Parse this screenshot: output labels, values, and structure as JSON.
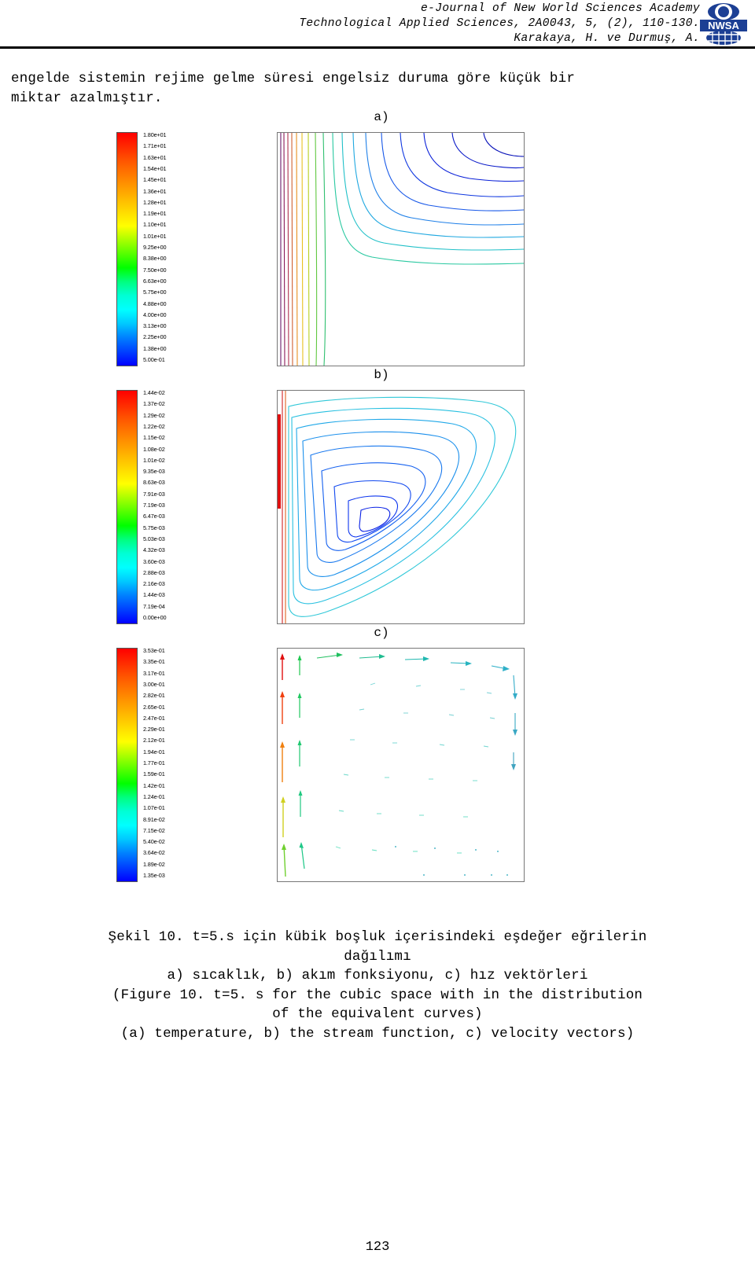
{
  "header": {
    "line1": "e-Journal of New World Sciences Academy",
    "line2": "Technological Applied Sciences, 2A0043, 5, (2), 110-130.",
    "line3": "Karakaya, H. ve Durmuş, A.",
    "logo_alt": "nwsa-logo"
  },
  "body": {
    "paragraph_line1": "engelde sistemin rejime gelme süresi engelsiz duruma göre küçük bir",
    "paragraph_line2": "miktar azalmıştır."
  },
  "figure": {
    "panels": [
      {
        "label": "a)",
        "name": "temperature-contour",
        "colorbar": {
          "ticks": [
            "1.80e+01",
            "1.71e+01",
            "1.63e+01",
            "1.54e+01",
            "1.45e+01",
            "1.36e+01",
            "1.28e+01",
            "1.19e+01",
            "1.10e+01",
            "1.01e+01",
            "9.25e+00",
            "8.38e+00",
            "7.50e+00",
            "6.63e+00",
            "5.75e+00",
            "4.88e+00",
            "4.00e+00",
            "3.13e+00",
            "2.25e+00",
            "1.38e+00",
            "5.00e-01"
          ]
        }
      },
      {
        "label": "b)",
        "name": "stream-function-contour",
        "colorbar": {
          "ticks": [
            "1.44e-02",
            "1.37e-02",
            "1.29e-02",
            "1.22e-02",
            "1.15e-02",
            "1.08e-02",
            "1.01e-02",
            "9.35e-03",
            "8.63e-03",
            "7.91e-03",
            "7.19e-03",
            "6.47e-03",
            "5.75e-03",
            "5.03e-03",
            "4.32e-03",
            "3.60e-03",
            "2.88e-03",
            "2.16e-03",
            "1.44e-03",
            "7.19e-04",
            "0.00e+00"
          ]
        }
      },
      {
        "label": "c)",
        "name": "velocity-vectors",
        "colorbar": {
          "ticks": [
            "3.53e-01",
            "3.35e-01",
            "3.17e-01",
            "3.00e-01",
            "2.82e-01",
            "2.65e-01",
            "2.47e-01",
            "2.29e-01",
            "2.12e-01",
            "1.94e-01",
            "1.77e-01",
            "1.59e-01",
            "1.42e-01",
            "1.24e-01",
            "1.07e-01",
            "8.91e-02",
            "7.15e-02",
            "5.40e-02",
            "3.64e-02",
            "1.89e-02",
            "1.35e-03"
          ]
        }
      }
    ],
    "colors": {
      "max": "#ff0000",
      "mid": "#00ff00",
      "min": "#0000ff"
    }
  },
  "caption": {
    "line1": "Şekil 10. t=5.s için kübik boşluk içerisindeki eşdeğer eğrilerin",
    "line2": "dağılımı",
    "line3": "a) sıcaklık, b) akım fonksiyonu, c) hız vektörleri",
    "line4": "(Figure 10. t=5. s for the cubic space with in the distribution",
    "line5": "of the equivalent curves)",
    "line6": "(a) temperature, b) the stream function, c) velocity vectors)"
  },
  "footer": {
    "page_number": "123"
  }
}
